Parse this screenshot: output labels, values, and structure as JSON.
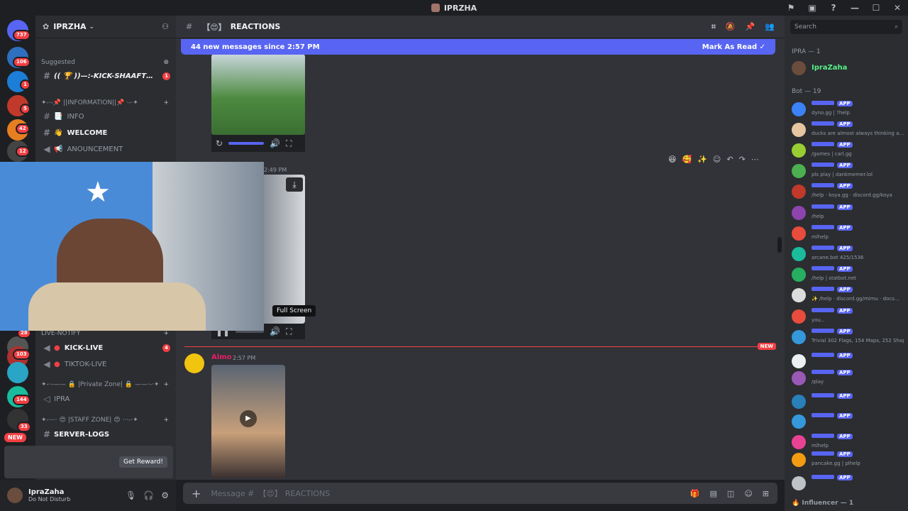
{
  "window": {
    "title": "IPRZHA"
  },
  "rail": {
    "badges": [
      "737",
      "106",
      "1",
      "5",
      "42",
      "12",
      "103",
      "144",
      "33",
      "28"
    ],
    "new_label": "NEW"
  },
  "server": {
    "name": "IPRZHA"
  },
  "sidebar": {
    "suggested_label": "Suggested",
    "suggested_channel": "(( 🏆 ))—:-KICK-SHAAFT…",
    "suggested_badge": "1",
    "info_category": "✦-·-📌 ||INFORMATION||📌 ·-·✦",
    "channels_top": [
      {
        "label": "INFO",
        "emoji": "📑"
      },
      {
        "label": "WELCOME",
        "emoji": "👋"
      },
      {
        "label": "ANOUNCEMENT",
        "emoji": "📢"
      }
    ],
    "live_category": "LIVE-NOTIFY",
    "live_channels": [
      {
        "label": "KICK-LIVE",
        "badge": "4"
      },
      {
        "label": "TIKTOK-LIVE"
      }
    ],
    "private_category": "✦-·-—— 🔒 |Private Zone| 🔒 ——·-·✦",
    "private_channel": "IPRA",
    "staff_category": "✦-·-·· 😍 |STAFF ZONE| 😍 ···-·✦",
    "staff_channel": "SERVER-LOGS",
    "promo_button": "Get Reward!"
  },
  "user": {
    "name": "IpraZaha",
    "status": "Do Not Disturb"
  },
  "chat": {
    "channel_name": "REACTIONS",
    "new_messages_text": "44 new messages since 2:57 PM",
    "mark_as_read": "Mark As Read",
    "msg1_time": "2:49 PM",
    "tooltip": "Full Screen",
    "new_divider": "NEW",
    "msg2_author": "Almo",
    "msg2_time": "2:57 PM",
    "composer_placeholder": "Message #",
    "composer_channel": "REACTIONS"
  },
  "search": {
    "placeholder": "Search"
  },
  "members": {
    "owner_category": "IPRA — 1",
    "owner_name": "IpraZaha",
    "bot_category": "Bot — 19",
    "bots": [
      {
        "sub": "dyno.gg | ?help",
        "color": "#3b82f6"
      },
      {
        "sub": "ducks are almost always thinking a…",
        "color": "#e6c6a0"
      },
      {
        "sub": "/games | carl.gg",
        "color": "#9acd32"
      },
      {
        "sub": "pls play | dankmemer.lol",
        "color": "#4caf50"
      },
      {
        "sub": "/help · koya.gg · discord.gg/koya",
        "color": "#c0392b"
      },
      {
        "sub": "/help",
        "color": "#8e44ad"
      },
      {
        "sub": "mlhelp",
        "color": "#e74c3c"
      },
      {
        "sub": "arcane.bot 425/1536",
        "color": "#1abc9c"
      },
      {
        "sub": "/help | statbot.net",
        "color": "#27ae60"
      },
      {
        "sub": "✨ /help · discord.gg/mimu · docs…",
        "color": "#dcdcdc"
      },
      {
        "sub": "you..",
        "color": "#e74c3c"
      },
      {
        "sub": "Trivial 302 Flags, 154 Maps, 252 Shap…",
        "color": "#3498db"
      },
      {
        "sub": "",
        "color": "#ecf0f1"
      },
      {
        "sub": "/play",
        "color": "#9b59b6"
      },
      {
        "sub": "",
        "color": "#2980b9"
      },
      {
        "sub": "",
        "color": "#3498db"
      },
      {
        "sub": "mlhelp",
        "color": "#e84393"
      },
      {
        "sub": "pancake.gg | plhelp",
        "color": "#f39c12"
      },
      {
        "sub": "",
        "color": "#bdc3c7"
      }
    ],
    "app_label": "APP",
    "influencer_category": "🔥 Influencer — 1"
  }
}
